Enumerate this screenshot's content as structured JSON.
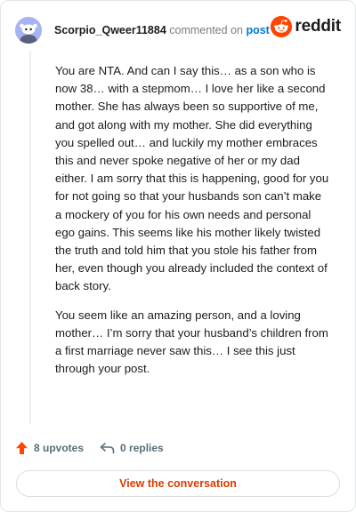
{
  "header": {
    "username": "Scorpio_Qweer11884",
    "action_text": "commented on",
    "post_link": "post",
    "brand": "reddit"
  },
  "comment": {
    "paragraphs": [
      "You are NTA. And can I say this… as a son who is now 38… with a stepmom… I love her like a second mother. She has always been so supportive of me, and got along with my mother. She did everything you spelled out… and luckily my mother embraces this and never spoke negative of her or my dad either. I am sorry that this is happening, good for you for not going so that your husbands son can’t make a mockery of you for his own needs and personal ego gains. This seems like his mother likely twisted the truth and told him that you stole his father from her, even though you already included the context of back story.",
      "You seem like an amazing person, and a loving mother… I’m sorry that your husband’s children from a first marriage never saw this… I see this just through your post."
    ]
  },
  "footer": {
    "upvotes": "8 upvotes",
    "replies": "0 replies",
    "cta": "View the conversation"
  },
  "colors": {
    "accent": "#d93a00",
    "upvote": "#ff4500",
    "link": "#0079d3",
    "brand_orange": "#ff4500"
  },
  "icons": {
    "avatar": "snoo-avatar-icon",
    "brand": "reddit-logo-icon",
    "upvote": "upvote-arrow-icon",
    "reply": "reply-arrow-icon"
  }
}
